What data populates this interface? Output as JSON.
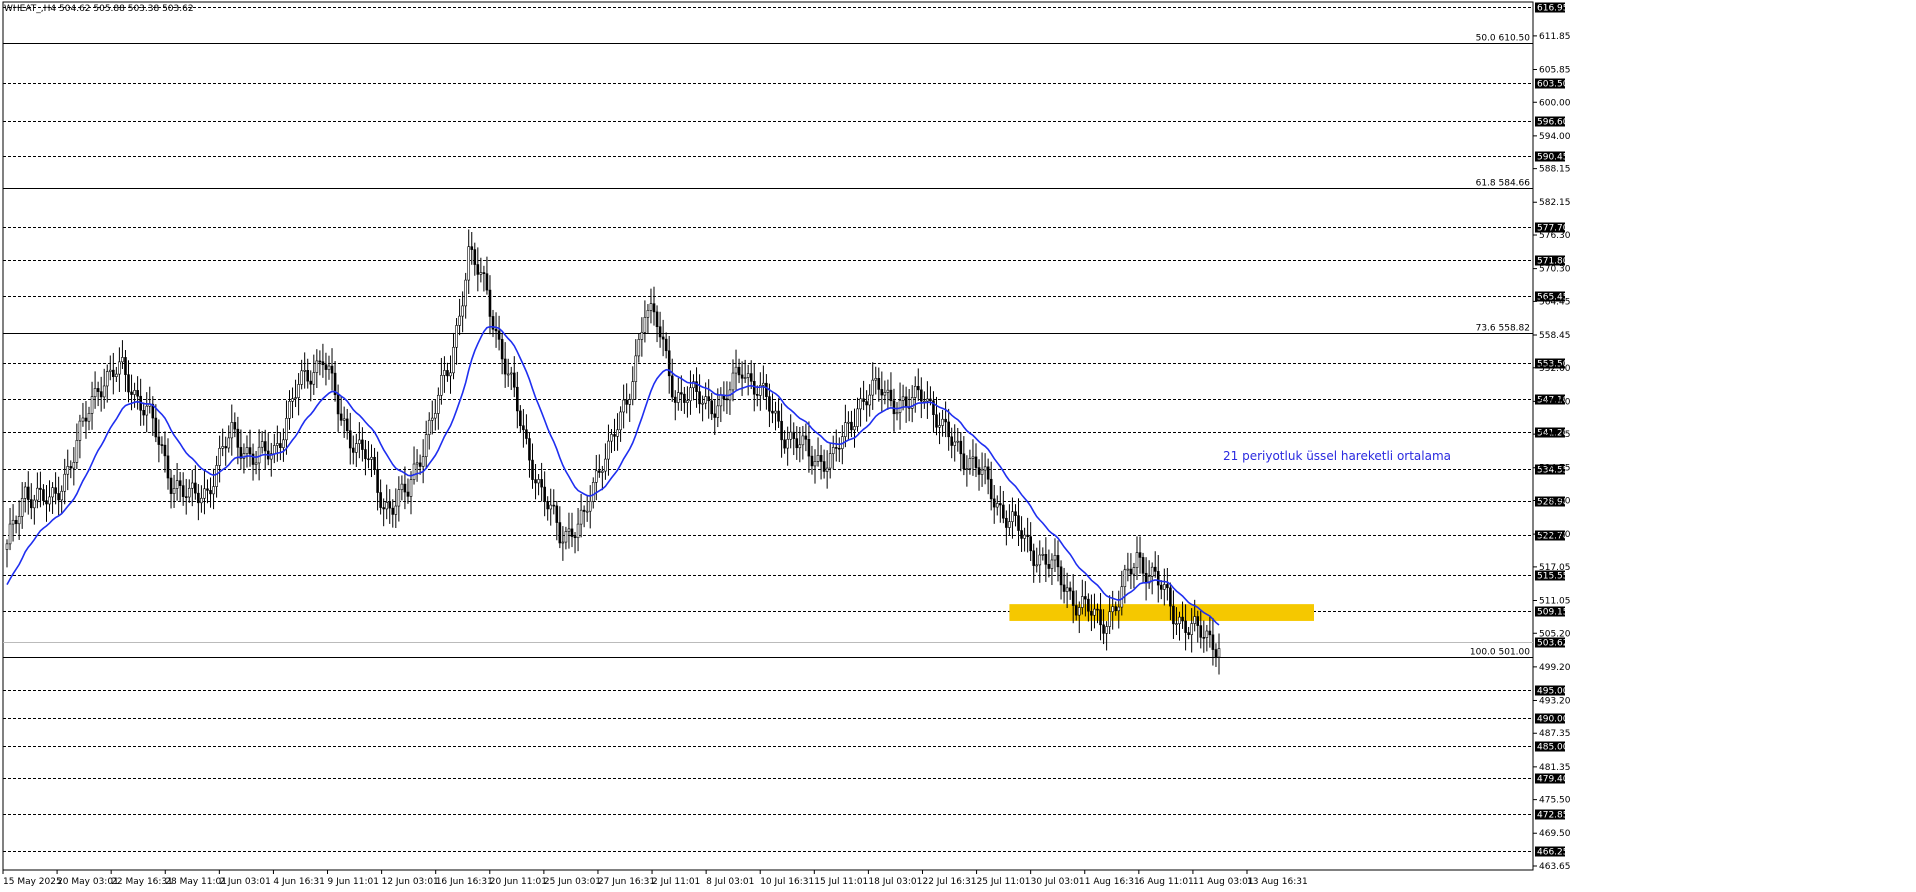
{
  "header": {
    "title": "WHEAT_,H4  504.62 505.88 503.38 503.62"
  },
  "annotation": {
    "text": "21 periyotluk üssel hareketli ortalama",
    "color": "#2a2ae0"
  },
  "colors": {
    "ema": "#1f2ff0",
    "zone": "#f5c800",
    "candle": "#000000",
    "grid": "#000000"
  },
  "chart_data": {
    "type": "candlestick",
    "symbol": "WHEAT_",
    "timeframe": "H4",
    "ylim": [
      463.65,
      617.9
    ],
    "grid": "horizontal dashed at labeled levels",
    "x_ticks": [
      "15 May 2025",
      "20 May 03:01",
      "22 May 16:31",
      "28 May 11:01",
      "2 Jun 03:01",
      "4 Jun 16:31",
      "9 Jun 11:01",
      "12 Jun 03:01",
      "16 Jun 16:31",
      "20 Jun 11:01",
      "25 Jun 03:01",
      "27 Jun 16:31",
      "2 Jul 11:01",
      "8 Jul 03:01",
      "10 Jul 16:31",
      "15 Jul 11:01",
      "18 Jul 03:01",
      "22 Jul 16:31",
      "25 Jul 11:01",
      "30 Jul 03:01",
      "1 Aug 16:31",
      "6 Aug 11:01",
      "11 Aug 03:01",
      "13 Aug 16:31"
    ],
    "y_ticks": [
      "611.85",
      "605.85",
      "600.00",
      "594.00",
      "588.15",
      "582.15",
      "576.30",
      "570.30",
      "564.45",
      "558.45",
      "552.60",
      "546.60",
      "540.75",
      "534.75",
      "528.90",
      "522.90",
      "517.05",
      "511.05",
      "505.20",
      "499.20",
      "493.20",
      "487.35",
      "481.35",
      "475.50",
      "469.50",
      "463.65"
    ],
    "levels": [
      {
        "label": "616.95",
        "value": 616.95
      },
      {
        "label": "603.50",
        "value": 603.5
      },
      {
        "label": "596.60",
        "value": 596.6
      },
      {
        "label": "590.45",
        "value": 590.45
      },
      {
        "label": "577.70",
        "value": 577.7
      },
      {
        "label": "571.80",
        "value": 571.8
      },
      {
        "label": "565.45",
        "value": 565.45
      },
      {
        "label": "553.50",
        "value": 553.5
      },
      {
        "label": "547.10",
        "value": 547.1
      },
      {
        "label": "541.20",
        "value": 541.2
      },
      {
        "label": "534.55",
        "value": 534.55
      },
      {
        "label": "528.90",
        "value": 528.9
      },
      {
        "label": "522.70",
        "value": 522.7
      },
      {
        "label": "515.55",
        "value": 515.55
      },
      {
        "label": "509.15",
        "value": 509.15
      },
      {
        "label": "503.62",
        "value": 503.62
      },
      {
        "label": "495.00",
        "value": 495.0
      },
      {
        "label": "490.00",
        "value": 490.0
      },
      {
        "label": "485.00",
        "value": 485.0
      },
      {
        "label": "479.40",
        "value": 479.4
      },
      {
        "label": "472.85",
        "value": 472.85
      },
      {
        "label": "466.25",
        "value": 466.25
      }
    ],
    "fibonacci": [
      {
        "label": "50.0 610.50",
        "value": 610.5
      },
      {
        "label": "61.8 584.66",
        "value": 584.66
      },
      {
        "label": "73.6 558.82",
        "value": 558.82
      },
      {
        "label": "100.0 501.00",
        "value": 501.0
      }
    ],
    "zone": {
      "from_value": 507.4,
      "to_value": 510.4
    },
    "last_price": 503.62,
    "ema_period": 21,
    "close_anchors": [
      {
        "i": 0,
        "v": 520
      },
      {
        "i": 6,
        "v": 531
      },
      {
        "i": 14,
        "v": 528
      },
      {
        "i": 22,
        "v": 537
      },
      {
        "i": 30,
        "v": 550
      },
      {
        "i": 38,
        "v": 552
      },
      {
        "i": 46,
        "v": 545
      },
      {
        "i": 54,
        "v": 533
      },
      {
        "i": 60,
        "v": 529
      },
      {
        "i": 66,
        "v": 531
      },
      {
        "i": 74,
        "v": 541
      },
      {
        "i": 82,
        "v": 536
      },
      {
        "i": 88,
        "v": 538
      },
      {
        "i": 96,
        "v": 549
      },
      {
        "i": 104,
        "v": 555
      },
      {
        "i": 110,
        "v": 543
      },
      {
        "i": 118,
        "v": 537
      },
      {
        "i": 124,
        "v": 528
      },
      {
        "i": 132,
        "v": 530
      },
      {
        "i": 138,
        "v": 541
      },
      {
        "i": 146,
        "v": 553
      },
      {
        "i": 152,
        "v": 573
      },
      {
        "i": 158,
        "v": 566
      },
      {
        "i": 164,
        "v": 553
      },
      {
        "i": 170,
        "v": 541
      },
      {
        "i": 176,
        "v": 530
      },
      {
        "i": 182,
        "v": 523
      },
      {
        "i": 190,
        "v": 525
      },
      {
        "i": 196,
        "v": 537
      },
      {
        "i": 204,
        "v": 545
      },
      {
        "i": 210,
        "v": 564
      },
      {
        "i": 214,
        "v": 560
      },
      {
        "i": 220,
        "v": 548
      },
      {
        "i": 228,
        "v": 547
      },
      {
        "i": 236,
        "v": 546
      },
      {
        "i": 242,
        "v": 553
      },
      {
        "i": 248,
        "v": 548
      },
      {
        "i": 256,
        "v": 541
      },
      {
        "i": 264,
        "v": 537
      },
      {
        "i": 272,
        "v": 536
      },
      {
        "i": 280,
        "v": 546
      },
      {
        "i": 288,
        "v": 549
      },
      {
        "i": 296,
        "v": 545
      },
      {
        "i": 302,
        "v": 549
      },
      {
        "i": 308,
        "v": 541
      },
      {
        "i": 314,
        "v": 538
      },
      {
        "i": 320,
        "v": 534
      },
      {
        "i": 328,
        "v": 527
      },
      {
        "i": 336,
        "v": 521
      },
      {
        "i": 344,
        "v": 517
      },
      {
        "i": 352,
        "v": 511
      },
      {
        "i": 360,
        "v": 507
      },
      {
        "i": 366,
        "v": 511
      },
      {
        "i": 372,
        "v": 519
      },
      {
        "i": 378,
        "v": 515
      },
      {
        "i": 384,
        "v": 509
      },
      {
        "i": 392,
        "v": 505
      },
      {
        "i": 399,
        "v": 503.62
      }
    ],
    "bars_count": 400
  }
}
